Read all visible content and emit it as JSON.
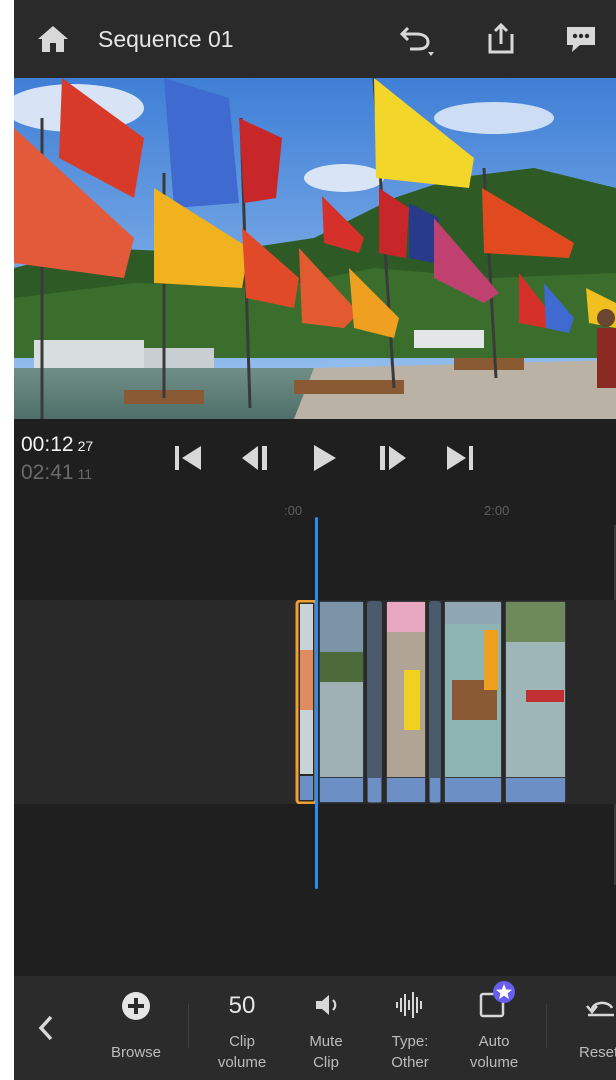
{
  "header": {
    "title": "Sequence 01",
    "icons": [
      "home-icon",
      "undo-icon",
      "share-icon",
      "comment-icon"
    ]
  },
  "transport": {
    "current_time": "00:12",
    "current_frames": "27",
    "total_time": "02:41",
    "total_frames": "11"
  },
  "timeline": {
    "ruler_start": ":00",
    "ruler_mark": "2:00"
  },
  "toolbar": {
    "browse_label": "Browse",
    "clip_volume_value": "50",
    "clip_volume_label_1": "Clip",
    "clip_volume_label_2": "volume",
    "mute_label_1": "Mute",
    "mute_label_2": "Clip",
    "type_label_1": "Type:",
    "type_label_2": "Other",
    "auto_label_1": "Auto",
    "auto_label_2": "volume",
    "reset_label": "Reset"
  },
  "colors": {
    "accent": "#2f8cf2",
    "selection": "#f0a030",
    "badge": "#6b5cf0",
    "waveform": "#6c8fc6"
  }
}
